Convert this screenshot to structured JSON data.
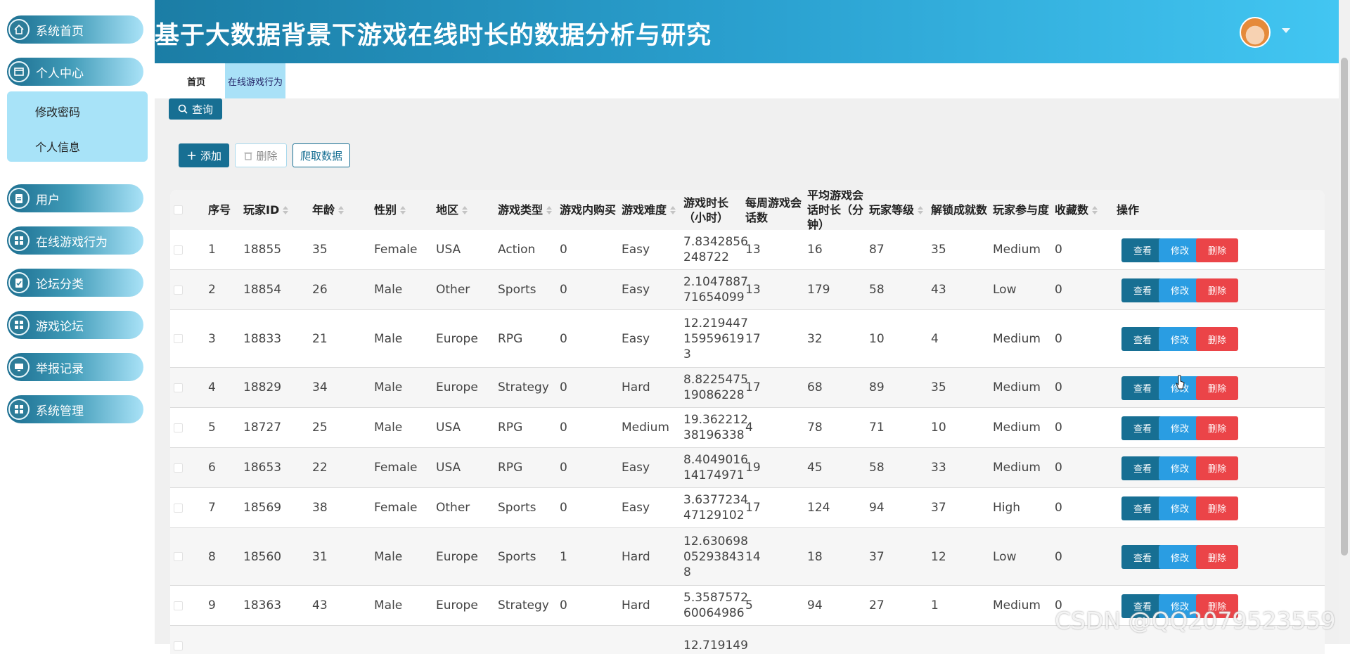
{
  "header": {
    "title": "基于大数据背景下游戏在线时长的数据分析与研究"
  },
  "sidebar": {
    "items": [
      {
        "label": "系统首页",
        "icon": "home-icon"
      },
      {
        "label": "个人中心",
        "icon": "id-card-icon"
      },
      {
        "label": "用户",
        "icon": "clipboard-icon"
      },
      {
        "label": "在线游戏行为",
        "icon": "grid-icon"
      },
      {
        "label": "论坛分类",
        "icon": "checklist-icon"
      },
      {
        "label": "游戏论坛",
        "icon": "grid-icon"
      },
      {
        "label": "举报记录",
        "icon": "monitor-icon"
      },
      {
        "label": "系统管理",
        "icon": "grid-icon"
      }
    ],
    "submenu": [
      "修改密码",
      "个人信息"
    ]
  },
  "tabs": [
    {
      "label": "首页"
    },
    {
      "label": "在线游戏行为"
    }
  ],
  "toolbar": {
    "search": "查询",
    "add": "添加",
    "delete": "删除",
    "crawl": "爬取数据"
  },
  "table": {
    "columns": [
      "序号",
      "玩家ID",
      "年龄",
      "性别",
      "地区",
      "游戏类型",
      "游戏内购买",
      "游戏难度",
      "游戏时长（小时）",
      "每周游戏会话数",
      "平均游戏会话时长（分钟）",
      "玩家等级",
      "解锁成就数",
      "玩家参与度",
      "收藏数",
      "操作"
    ],
    "actions": {
      "view": "查看",
      "edit": "修改",
      "delete": "删除"
    },
    "rows": [
      {
        "no": "1",
        "id": "18855",
        "age": "35",
        "gender": "Female",
        "region": "USA",
        "type": "Action",
        "purchase": "0",
        "difficulty": "Easy",
        "hours": "7.8342856\n248722",
        "sessions": "13",
        "avg": "16",
        "level": "87",
        "ach": "35",
        "engagement": "Medium",
        "fav": "0"
      },
      {
        "no": "2",
        "id": "18854",
        "age": "26",
        "gender": "Male",
        "region": "Other",
        "type": "Sports",
        "purchase": "0",
        "difficulty": "Easy",
        "hours": "2.1047887\n71654099",
        "sessions": "13",
        "avg": "179",
        "level": "58",
        "ach": "43",
        "engagement": "Low",
        "fav": "0"
      },
      {
        "no": "3",
        "id": "18833",
        "age": "21",
        "gender": "Male",
        "region": "Europe",
        "type": "RPG",
        "purchase": "0",
        "difficulty": "Easy",
        "hours": "12.219447\n15959619\n3",
        "sessions": "17",
        "avg": "32",
        "level": "10",
        "ach": "4",
        "engagement": "Medium",
        "fav": "0"
      },
      {
        "no": "4",
        "id": "18829",
        "age": "34",
        "gender": "Male",
        "region": "Europe",
        "type": "Strategy",
        "purchase": "0",
        "difficulty": "Hard",
        "hours": "8.8225475\n19086228",
        "sessions": "17",
        "avg": "68",
        "level": "89",
        "ach": "35",
        "engagement": "Medium",
        "fav": "0"
      },
      {
        "no": "5",
        "id": "18727",
        "age": "25",
        "gender": "Male",
        "region": "USA",
        "type": "RPG",
        "purchase": "0",
        "difficulty": "Medium",
        "hours": "19.362212\n38196338",
        "sessions": "4",
        "avg": "78",
        "level": "71",
        "ach": "10",
        "engagement": "Medium",
        "fav": "0"
      },
      {
        "no": "6",
        "id": "18653",
        "age": "22",
        "gender": "Female",
        "region": "USA",
        "type": "RPG",
        "purchase": "0",
        "difficulty": "Easy",
        "hours": "8.4049016\n14174971",
        "sessions": "19",
        "avg": "45",
        "level": "58",
        "ach": "33",
        "engagement": "Medium",
        "fav": "0"
      },
      {
        "no": "7",
        "id": "18569",
        "age": "38",
        "gender": "Female",
        "region": "Other",
        "type": "Sports",
        "purchase": "0",
        "difficulty": "Easy",
        "hours": "3.6377234\n47129102",
        "sessions": "17",
        "avg": "124",
        "level": "94",
        "ach": "37",
        "engagement": "High",
        "fav": "0"
      },
      {
        "no": "8",
        "id": "18560",
        "age": "31",
        "gender": "Male",
        "region": "Europe",
        "type": "Sports",
        "purchase": "1",
        "difficulty": "Hard",
        "hours": "12.630698\n05293843\n8",
        "sessions": "14",
        "avg": "18",
        "level": "37",
        "ach": "12",
        "engagement": "Low",
        "fav": "0"
      },
      {
        "no": "9",
        "id": "18363",
        "age": "43",
        "gender": "Male",
        "region": "Europe",
        "type": "Strategy",
        "purchase": "0",
        "difficulty": "Hard",
        "hours": "5.3587572\n60064986",
        "sessions": "5",
        "avg": "94",
        "level": "27",
        "ach": "1",
        "engagement": "Medium",
        "fav": "0"
      },
      {
        "no": "",
        "id": "",
        "age": "",
        "gender": "",
        "region": "",
        "type": "",
        "purchase": "",
        "difficulty": "",
        "hours": "12.719149",
        "sessions": "",
        "avg": "",
        "level": "",
        "ach": "",
        "engagement": "",
        "fav": ""
      }
    ]
  },
  "watermark": "CSDN @QQ2079523559",
  "colors": {
    "primary": "#176f93",
    "edit": "#2a9de2",
    "danger": "#eb4448",
    "header_start": "#1b7da5",
    "header_end": "#42c6f2"
  }
}
